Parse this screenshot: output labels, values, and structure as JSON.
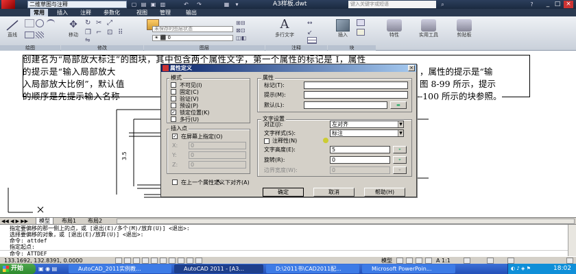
{
  "titlebar": {
    "workspace": "二维草图与注释",
    "document": "A3样板.dwt",
    "search_placeholder": "键入关键字或短语",
    "minimize": "_",
    "restore": "□",
    "close": "×"
  },
  "ribbon_tabs": [
    "常用",
    "插入",
    "注释",
    "参数化",
    "视图",
    "管理",
    "输出"
  ],
  "ribbon": {
    "line": "直线",
    "move": "移动",
    "layer_state": "未保存的图层状态",
    "multiline_text": "多行文字",
    "insert": "插入",
    "properties": "特性",
    "utilities": "实用工具",
    "clipboard": "剪贴板",
    "panels": [
      "绘图",
      "修改",
      "图层",
      "注释",
      "块"
    ]
  },
  "doc_text": [
    "创建名为“局部放大标注”的图块，其中包含两个属性文字，第一个属性的标记是 I，属性",
    "的提示是“输入局部放大",
    "入局部放大比例”，默认值",
    "的顺序是先提示输入名称"
  ],
  "doc_text_right": [
    "，属性的提示是“输",
    "图 8-99 所示，提示",
    "-100 所示的块参照。"
  ],
  "dialog": {
    "title": "属性定义",
    "mode_group": "模式",
    "modes": [
      {
        "label": "不可见(I)",
        "checked": false
      },
      {
        "label": "固定(C)",
        "checked": false
      },
      {
        "label": "验证(V)",
        "checked": false
      },
      {
        "label": "预设(P)",
        "checked": false
      },
      {
        "label": "锁定位置(K)",
        "checked": true
      },
      {
        "label": "多行(U)",
        "checked": false
      }
    ],
    "attribute_group": "属性",
    "tag_label": "标记(T):",
    "prompt_label": "提示(M):",
    "default_label": "默认(L):",
    "insert_group": "插入点",
    "specify_on_screen": "在屏幕上指定(O)",
    "x_label": "X:",
    "y_label": "Y:",
    "z_label": "Z:",
    "x_val": "0",
    "y_val": "0",
    "z_val": "0",
    "text_group": "文字设置",
    "justify_label": "对正(J):",
    "justify_value": "左对齐",
    "style_label": "文字样式(S):",
    "style_value": "标注",
    "annotative_label": "注释性(N)",
    "height_label": "文字高度(E):",
    "height_value": "5",
    "rotation_label": "旋转(R):",
    "rotation_value": "0",
    "boundary_label": "边界宽度(W):",
    "boundary_value": "0",
    "align_below": "在上一个属性定义下对齐(A)",
    "ok": "确定",
    "cancel": "取消",
    "help": "帮助(H)"
  },
  "layout_tabs": [
    "模型",
    "布局1",
    "布局2"
  ],
  "command_lines": [
    "指定要偏移的那一侧上的点，或 [退出(E)/多个(M)/放弃(U)] <退出>:",
    "选择要偏移的对象，或 [退出(E)/放弃(U)] <退出>:",
    "命令: attdef",
    "指定起点:",
    "命令: ATTDEF"
  ],
  "status": {
    "coords": "133.1692, 132.8391, 0.0000",
    "model": "模型",
    "scale": "A 1:1"
  },
  "taskbar": {
    "start": "开始",
    "tasks": [
      "AutoCAD_2011实例教...",
      "AutoCAD 2011 - [A3...",
      "D:\\2011书\\CAD2011配...",
      "Microsoft PowerPoin..."
    ],
    "clock": "18:02"
  }
}
